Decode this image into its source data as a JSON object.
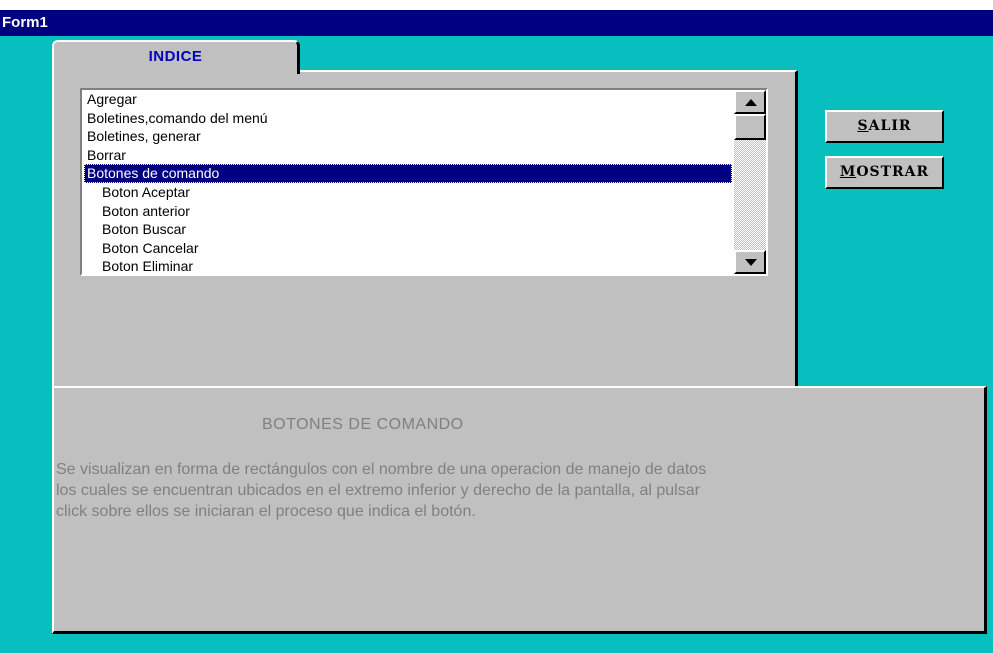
{
  "window": {
    "title": "Form1"
  },
  "tab": {
    "label": "INDICE"
  },
  "list": {
    "items": [
      {
        "label": "Agregar",
        "indent": false,
        "selected": false
      },
      {
        "label": "Boletines,comando del menú",
        "indent": false,
        "selected": false
      },
      {
        "label": "Boletines, generar",
        "indent": false,
        "selected": false
      },
      {
        "label": "Borrar",
        "indent": false,
        "selected": false
      },
      {
        "label": "Botones de comando",
        "indent": false,
        "selected": true
      },
      {
        "label": "Boton Aceptar",
        "indent": true,
        "selected": false
      },
      {
        "label": "Boton anterior",
        "indent": true,
        "selected": false
      },
      {
        "label": "Boton Buscar",
        "indent": true,
        "selected": false
      },
      {
        "label": "Boton Cancelar",
        "indent": true,
        "selected": false
      },
      {
        "label": "Boton Eliminar",
        "indent": true,
        "selected": false
      }
    ]
  },
  "buttons": {
    "salir": {
      "accel": "S",
      "rest": "ALIR"
    },
    "mostrar": {
      "accel": "M",
      "rest": "OSTRAR"
    }
  },
  "description": {
    "title": "BOTONES DE COMANDO",
    "line1": "Se visualizan en forma de rectángulos con el nombre de una operacion de manejo de datos",
    "line2": "los cuales se encuentran ubicados en el extremo inferior y derecho de la pantalla, al pulsar",
    "line3": "click sobre ellos se iniciaran el proceso que indica el botón."
  },
  "colors": {
    "titlebar": "#000080",
    "background": "#08bfbf",
    "panel": "#c0c0c0",
    "selection": "#000080",
    "tab_text": "#0000c0",
    "description_text": "#808080"
  }
}
